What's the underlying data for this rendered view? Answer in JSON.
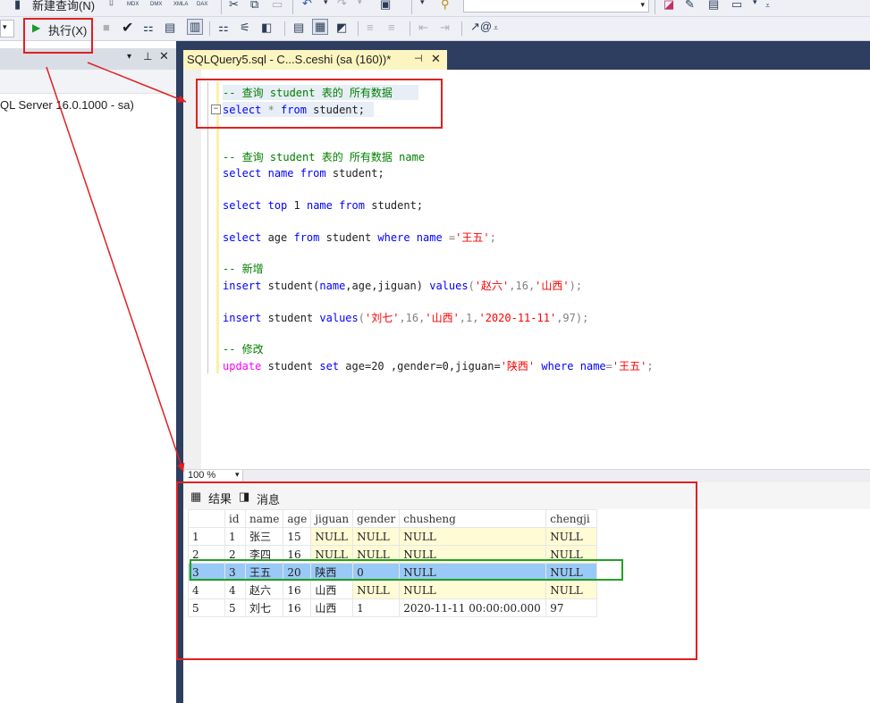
{
  "toolbar_top": {
    "new_query_label": "新建查询(N)",
    "small_icon_labels": [
      "MDX",
      "DMX",
      "XMLA",
      "DAX"
    ]
  },
  "toolbar_second": {
    "execute_label": "执行(X)"
  },
  "object_explorer": {
    "server_node": "QL Server 16.0.1000 - sa)"
  },
  "editor_tab": {
    "title": "SQLQuery5.sql - C...S.ceshi (sa (160))*",
    "pin_glyph": "⊣",
    "close_glyph": "✕"
  },
  "code": {
    "line1": {
      "comment": "-- 查询 student 表的 所有数据"
    },
    "line2": {
      "kw1": "select",
      "t1": " * ",
      "kw2": "from",
      "t2": " student;"
    },
    "line3": {
      "comment": "-- 查询 student 表的 所有数据 name"
    },
    "line4": {
      "kw1": "select",
      "t1": " ",
      "kw2": "name",
      "t2": " ",
      "kw3": "from",
      "t3": " student;"
    },
    "line5": {
      "kw1": "select",
      "t1": " ",
      "kw2": "top",
      "t2": " 1 ",
      "kw3": "name",
      "t3": " ",
      "kw4": "from",
      "t4": " student;"
    },
    "line6": {
      "kw1": "select",
      "t1": " age ",
      "kw2": "from",
      "t2": " student ",
      "kw3": "where",
      "t3": " ",
      "kw4": "name",
      "t4": " =",
      "s1": "'王五'",
      "t5": ";"
    },
    "line7": {
      "comment": "-- 新增"
    },
    "line8": {
      "kw1": "insert",
      "t1": " student(",
      "kw2": "name",
      "t2": ",age,jiguan) ",
      "kw3": "values",
      "t3": "(",
      "s1": "'赵六'",
      "t4": ",16,",
      "s2": "'山西'",
      "t5": ");"
    },
    "line9": {
      "kw1": "insert",
      "t1": " student ",
      "kw2": "values",
      "t2": "(",
      "s1": "'刘七'",
      "t3": ",16,",
      "s2": "'山西'",
      "t4": ",1,",
      "s3": "'2020-11-11'",
      "t5": ",97);"
    },
    "line10": {
      "comment": "-- 修改"
    },
    "line11": {
      "kw1": "update",
      "t1": " student ",
      "kw2": "set",
      "t2": " age=20 ,gender=0,jiguan=",
      "s1": "'陕西'",
      "t3": " ",
      "kw3": "where",
      "t4": " ",
      "kw4": "name",
      "t5": "=",
      "s2": "'王五'",
      "t6": ";"
    }
  },
  "zoom": {
    "value": "100 %"
  },
  "results_tabs": {
    "results": "结果",
    "messages": "消息"
  },
  "grid": {
    "columns": [
      "",
      "id",
      "name",
      "age",
      "jiguan",
      "gender",
      "chusheng",
      "chengji"
    ],
    "rows": [
      [
        "1",
        "1",
        "张三",
        "15",
        "NULL",
        "NULL",
        "NULL",
        "NULL"
      ],
      [
        "2",
        "2",
        "李四",
        "16",
        "NULL",
        "NULL",
        "NULL",
        "NULL"
      ],
      [
        "3",
        "3",
        "王五",
        "20",
        "陕西",
        "0",
        "NULL",
        "NULL"
      ],
      [
        "4",
        "4",
        "赵六",
        "16",
        "山西",
        "NULL",
        "NULL",
        "NULL"
      ],
      [
        "5",
        "5",
        "刘七",
        "16",
        "山西",
        "1",
        "2020-11-11 00:00:00.000",
        "97"
      ]
    ],
    "selected_row": 3
  },
  "colors": {
    "annotation_red": "#e02020",
    "annotation_green": "#22a022",
    "selected_row": "#99c9f6",
    "null_cell": "#fffbd5",
    "tab_active": "#fdf5c0",
    "frame_dark": "#2d3e60"
  }
}
